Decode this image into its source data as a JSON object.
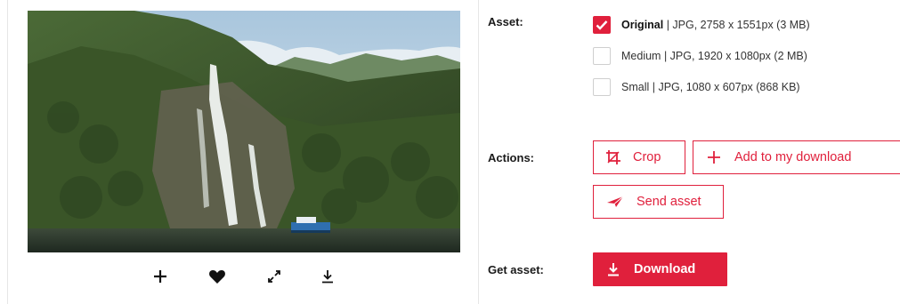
{
  "photo": {
    "alt": ""
  },
  "tools": {
    "add_icon": "plus-icon",
    "favorite_icon": "heart-icon",
    "fullscreen_icon": "expand-icon",
    "download_icon": "download-icon"
  },
  "asset": {
    "label": "Asset:",
    "options": [
      {
        "name": "Original",
        "details": " | JPG, 2758 x 1551px (3 MB)",
        "checked": true
      },
      {
        "name": "Medium",
        "details": " | JPG, 1920 x 1080px (2 MB)",
        "checked": false
      },
      {
        "name": "Small",
        "details": " | JPG, 1080 x 607px (868 KB)",
        "checked": false
      }
    ]
  },
  "actions": {
    "label": "Actions:",
    "crop_label": "Crop",
    "add_label": "Add to my download",
    "send_label": "Send asset"
  },
  "get_asset": {
    "label": "Get asset:",
    "download_label": "Download"
  },
  "colors": {
    "accent": "#e0203c"
  }
}
